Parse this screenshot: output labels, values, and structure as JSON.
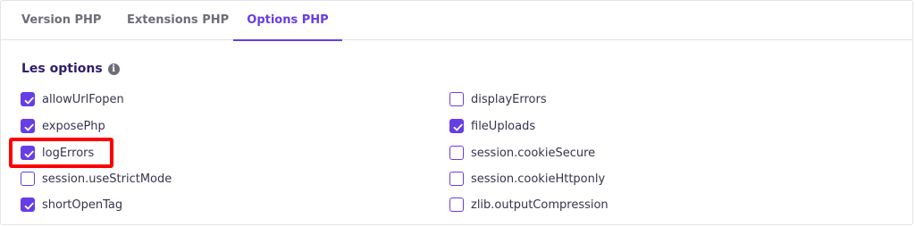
{
  "tabs": [
    {
      "label": "Version PHP",
      "active": false
    },
    {
      "label": "Extensions PHP",
      "active": false
    },
    {
      "label": "Options PHP",
      "active": true
    }
  ],
  "section": {
    "title": "Les options",
    "info_icon": "info-icon"
  },
  "options_left": [
    {
      "label": "allowUrlFopen",
      "checked": true
    },
    {
      "label": "exposePhp",
      "checked": true
    },
    {
      "label": "logErrors",
      "checked": true
    },
    {
      "label": "session.useStrictMode",
      "checked": false
    },
    {
      "label": "shortOpenTag",
      "checked": true
    }
  ],
  "options_right": [
    {
      "label": "displayErrors",
      "checked": false
    },
    {
      "label": "fileUploads",
      "checked": true
    },
    {
      "label": "session.cookieSecure",
      "checked": false
    },
    {
      "label": "session.cookieHttponly",
      "checked": false
    },
    {
      "label": "zlib.outputCompression",
      "checked": false
    }
  ],
  "colors": {
    "accent": "#673de6",
    "highlight": "#ff0000",
    "tab_inactive": "#6d6d7a",
    "heading": "#2f1c6a"
  }
}
